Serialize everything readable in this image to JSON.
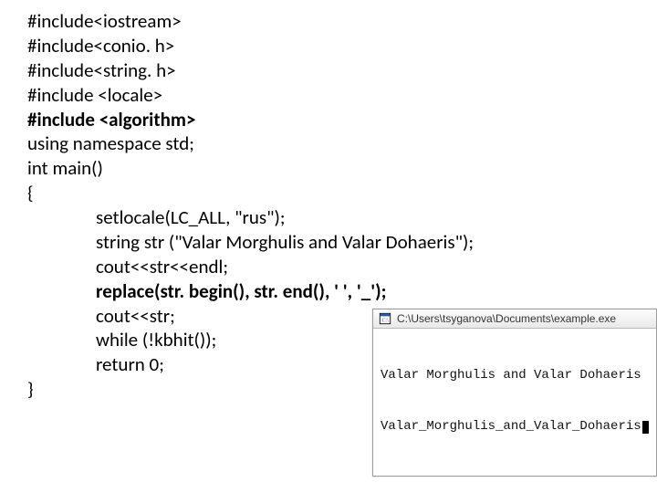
{
  "code": {
    "l1": "#include<iostream>",
    "l2": "#include<conio. h>",
    "l3": "#include<string. h>",
    "l4": "#include <locale>",
    "l5": "#include <algorithm>",
    "l6": "using namespace std;",
    "l7": "int main()",
    "l8": "{",
    "l9": "setlocale(LC_ALL, \"rus\");",
    "l10": "string str (\"Valar Morghulis and Valar Dohaeris\");",
    "l11": "cout<<str<<endl;",
    "l12": "replace(str. begin(), str. end(), ' ', '_');",
    "l13": "cout<<str;",
    "l14": "while (!kbhit());",
    "l15": "return 0;",
    "l16": "}"
  },
  "console": {
    "title": "C:\\Users\\tsyganova\\Documents\\example.exe",
    "line1": "Valar Morghulis and Valar Dohaeris",
    "line2": "Valar_Morghulis_and_Valar_Dohaeris"
  }
}
